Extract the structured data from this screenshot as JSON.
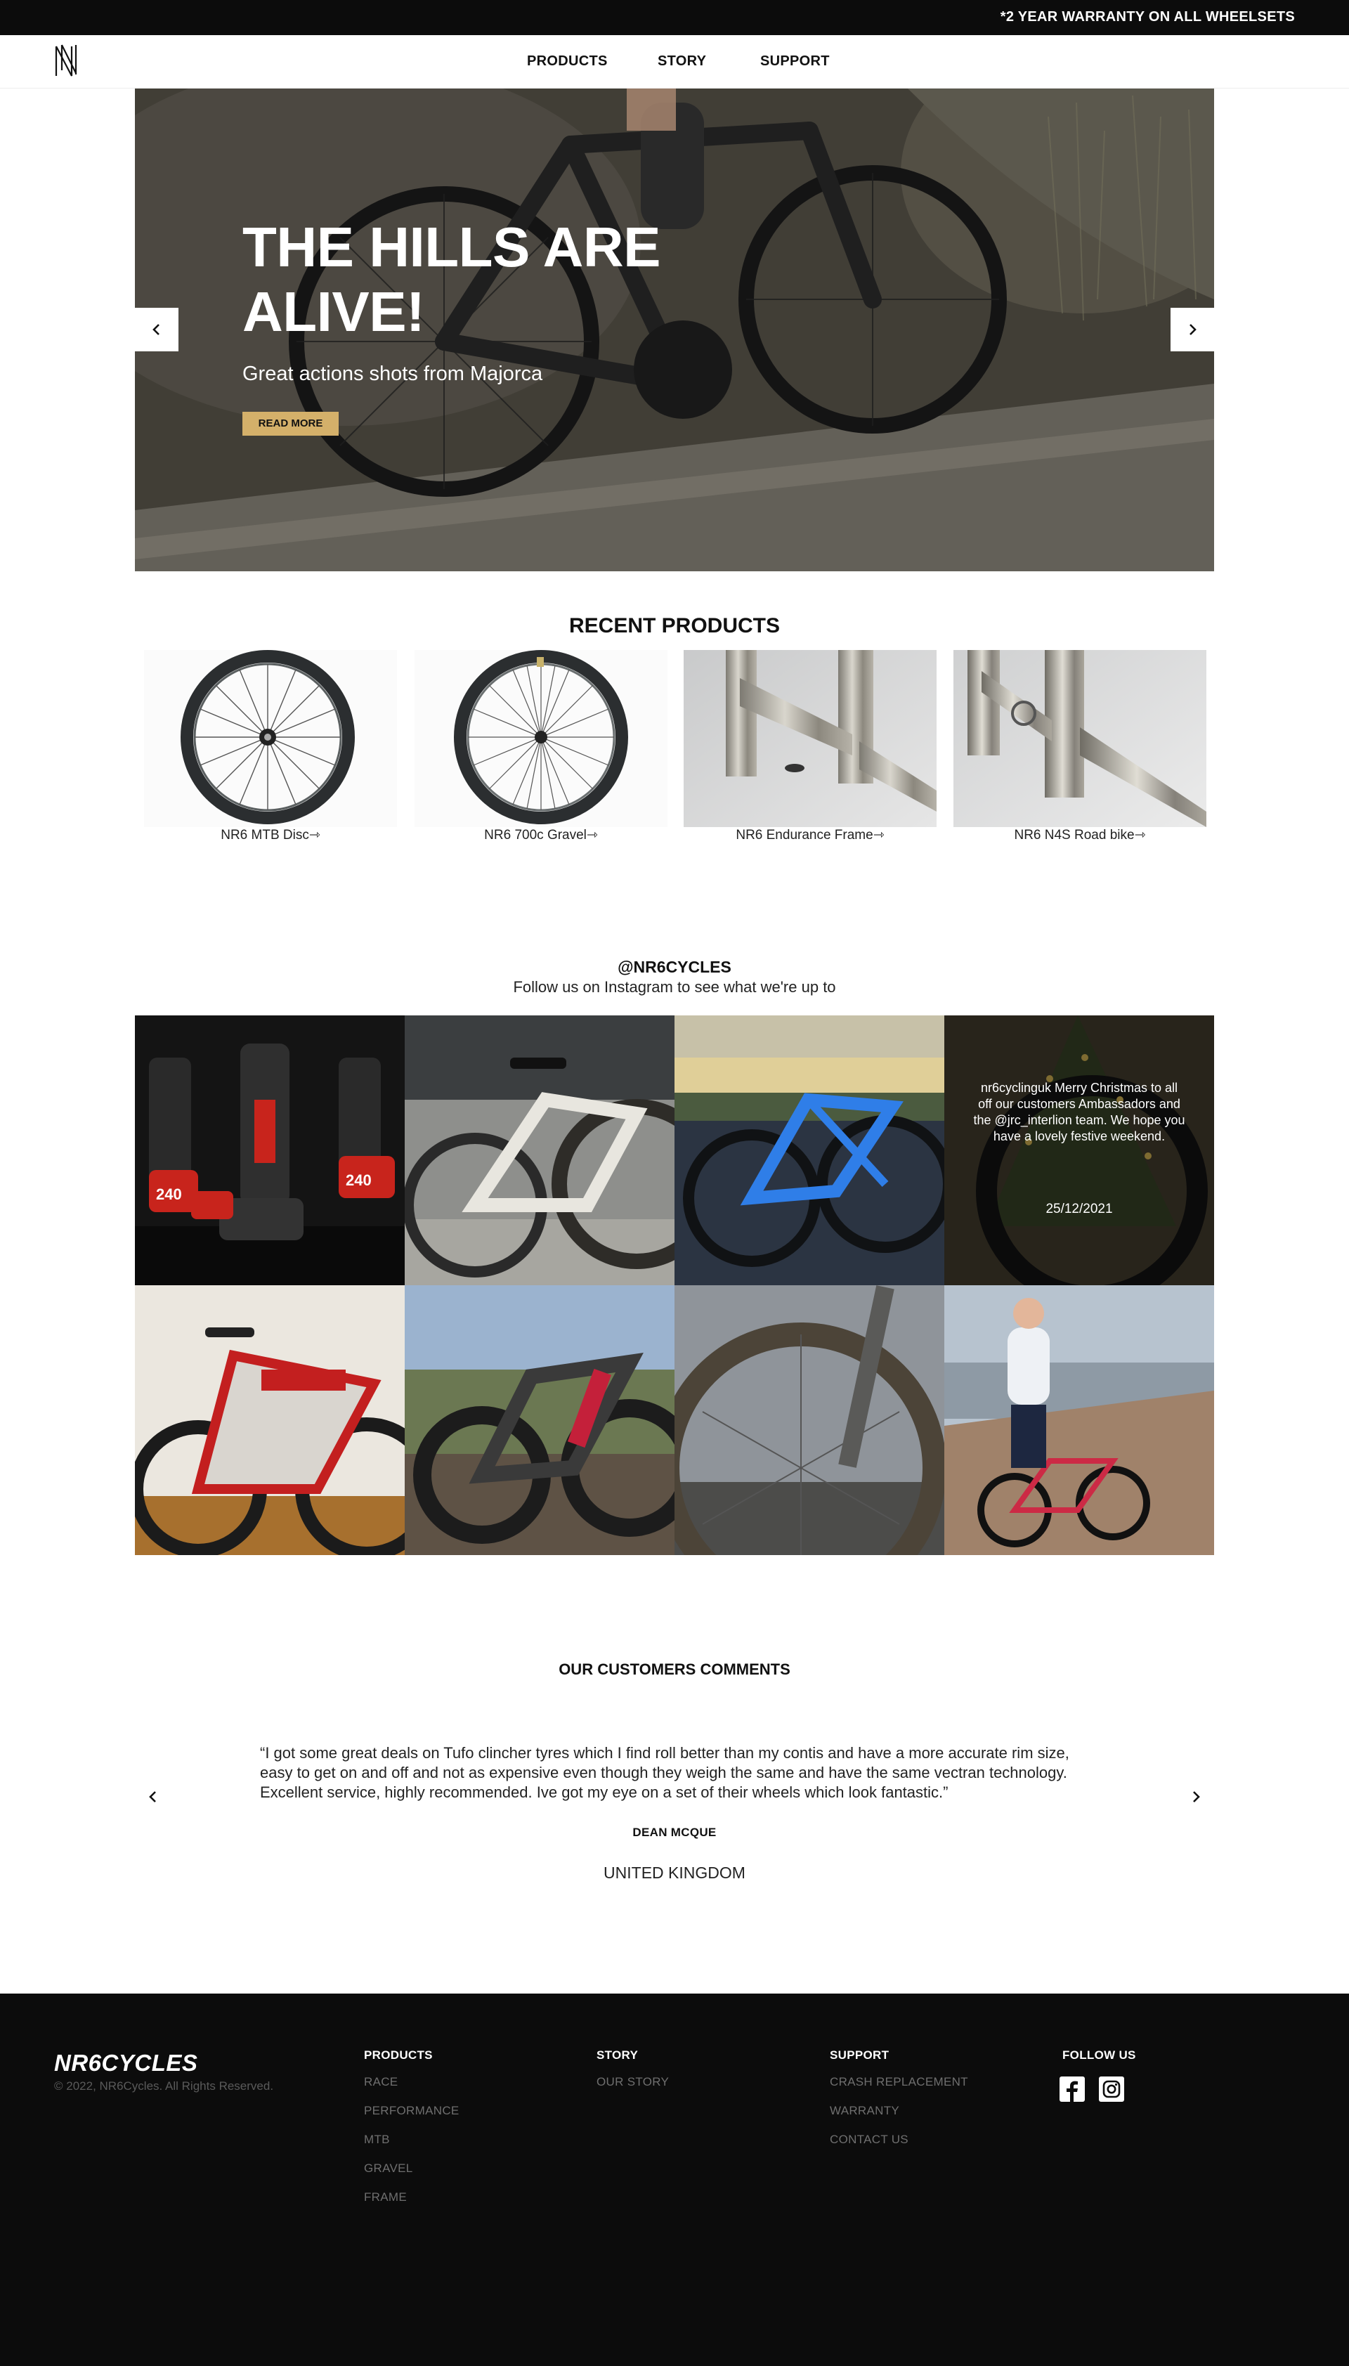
{
  "topbar": {
    "message": "*2 YEAR WARRANTY ON ALL WHEELSETS"
  },
  "nav": {
    "logo_icon": "nr6-monogram-logo",
    "links": [
      {
        "label": "PRODUCTS"
      },
      {
        "label": "STORY"
      },
      {
        "label": "SUPPORT"
      }
    ]
  },
  "hero": {
    "title": "THE HILLS ARE ALIVE!",
    "subtitle": "Great actions shots from Majorca",
    "button_label": "READ MORE",
    "prev_icon": "chevron-left-icon",
    "next_icon": "chevron-right-icon"
  },
  "recent_products": {
    "title": "RECENT PRODUCTS",
    "items": [
      {
        "label": "NR6 MTB Disc⇾",
        "image": "mtb-disc-wheel"
      },
      {
        "label": "NR6 700c Gravel⇾",
        "image": "gravel-wheel"
      },
      {
        "label": "NR6 Endurance Frame⇾",
        "image": "titanium-frame-closeup"
      },
      {
        "label": "NR6 N4S Road bike⇾",
        "image": "titanium-frame-closeup"
      }
    ]
  },
  "instagram": {
    "handle": "@NR6CYCLES",
    "subtitle": "Follow us on Instagram to see what we're up to",
    "tiles": [
      {
        "image": "dt-swiss-240-hubs"
      },
      {
        "image": "white-aero-bike-by-car"
      },
      {
        "image": "blue-road-bike-sunset"
      },
      {
        "image": "christmas-tree-wheel",
        "caption": "nr6cyclinguk Merry Christmas to all off our customers Ambassadors and the @jrc_interlion team. We hope you have a lovely festive weekend.",
        "date": "25/12/2021"
      },
      {
        "image": "red-white-tt-bike"
      },
      {
        "image": "full-suspension-mtb"
      },
      {
        "image": "muddy-gravel-wheel"
      },
      {
        "image": "rider-with-bike-on-mountain"
      }
    ]
  },
  "comments": {
    "title": "OUR CUSTOMERS COMMENTS",
    "quote": "“I got some great deals on Tufo clincher tyres which I find roll better than my contis and have a more accurate rim size, easy to get on and off and not as expensive even though they weigh the same and have the same vectran technology. Excellent service, highly recommended. Ive got my eye on a set of their wheels which look fantastic.”",
    "author": "DEAN MCQUE",
    "country": "UNITED KINGDOM"
  },
  "footer": {
    "brand": "NR6CYCLES",
    "copyright": "© 2022, NR6Cycles. All Rights Reserved.",
    "columns": [
      {
        "heading": "PRODUCTS",
        "links": [
          "RACE",
          "PERFORMANCE",
          "MTB",
          "GRAVEL",
          "FRAME"
        ]
      },
      {
        "heading": "STORY",
        "links": [
          "OUR STORY"
        ]
      },
      {
        "heading": "SUPPORT",
        "links": [
          "CRASH REPLACEMENT",
          "WARRANTY",
          "CONTACT US"
        ]
      },
      {
        "heading": "FOLLOW US",
        "links": []
      }
    ],
    "social": [
      "facebook-icon",
      "instagram-icon"
    ]
  },
  "colors": {
    "dark": "#0c0c0c",
    "accent": "#d4b06a",
    "footer_link": "#6f6f6f"
  }
}
